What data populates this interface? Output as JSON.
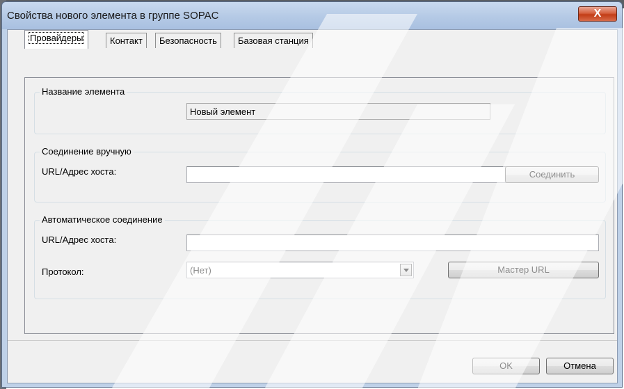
{
  "window": {
    "title": "Свойства нового элемента в группе SOPAC",
    "close_glyph": "X"
  },
  "tabs": [
    {
      "label": "Провайдеры",
      "active": true
    },
    {
      "label": "Контакт",
      "active": false
    },
    {
      "label": "Безопасность",
      "active": false
    },
    {
      "label": "Базовая станция",
      "active": false
    }
  ],
  "element_name": {
    "legend": "Название элемента",
    "value": "Новый элемент"
  },
  "manual": {
    "legend": "Соединение вручную",
    "url_label": "URL/Адрес хоста:",
    "url_value": "",
    "connect_button": "Соединить"
  },
  "auto": {
    "legend": "Автоматическое соединение",
    "url_label": "URL/Адрес хоста:",
    "url_value": "",
    "protocol_label": "Протокол:",
    "protocol_value": "(Нет)",
    "wizard_button": "Мастер URL"
  },
  "footer": {
    "ok_button": "OK",
    "cancel_button": "Отмена"
  },
  "colors": {
    "title_bar": "#bfd1e8",
    "close_button": "#c94a26",
    "dialog_bg": "#f0f0f0"
  }
}
